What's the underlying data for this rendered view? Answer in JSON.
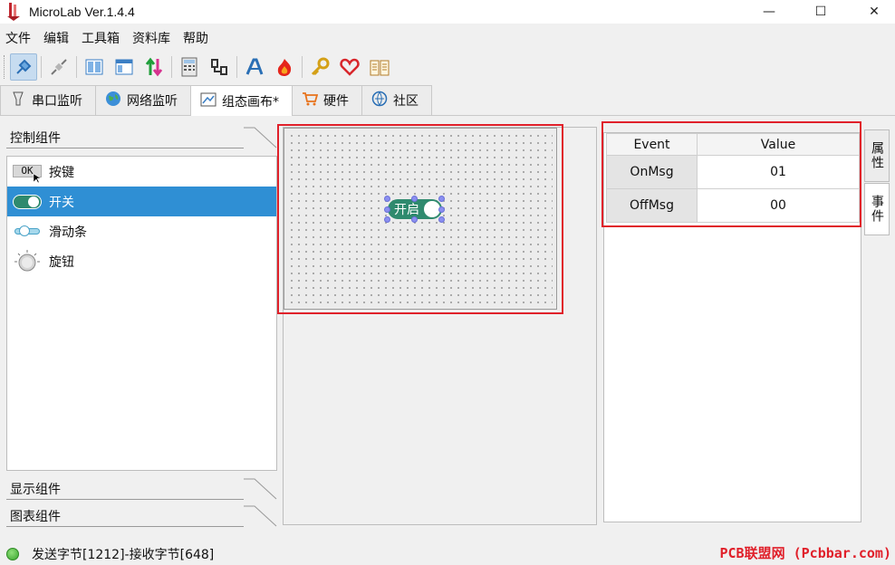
{
  "window": {
    "title": "MicroLab Ver.1.4.4",
    "minimize": "—",
    "maximize": "☐",
    "close": "✕"
  },
  "menu": [
    "文件",
    "编辑",
    "工具箱",
    "资料库",
    "帮助"
  ],
  "toolbar": {
    "icons": [
      "plug-icon",
      "disconnect-icon",
      "columns-icon",
      "layout-icon",
      "transfer-icon",
      "calculator-icon",
      "connector-icon",
      "font-icon",
      "flame-icon",
      "key-icon",
      "heart-icon",
      "book-icon"
    ]
  },
  "tabs": [
    {
      "label": "串口监听",
      "icon": "serial-icon"
    },
    {
      "label": "网络监听",
      "icon": "globe-icon"
    },
    {
      "label": "组态画布*",
      "icon": "canvas-icon",
      "active": true
    },
    {
      "label": "硬件",
      "icon": "cart-icon"
    },
    {
      "label": "社区",
      "icon": "community-icon"
    }
  ],
  "left_panel": {
    "control_header": "控制组件",
    "components": [
      {
        "label": "按键",
        "icon_text": "OK"
      },
      {
        "label": "开关",
        "selected": true
      },
      {
        "label": "滑动条"
      },
      {
        "label": "旋钮"
      }
    ],
    "display_header": "显示组件",
    "chart_header": "图表组件"
  },
  "canvas": {
    "switch_label": "开启"
  },
  "properties": {
    "col_event": "Event",
    "col_value": "Value",
    "rows": [
      {
        "event": "OnMsg",
        "value": "01"
      },
      {
        "event": "OffMsg",
        "value": "00"
      }
    ]
  },
  "side_tabs": [
    "属性",
    "事件"
  ],
  "status": {
    "text": "发送字节[1212]-接收字节[648]",
    "watermark": "PCB联盟网 (Pcbbar.com)",
    "led_color": "#3aa52e"
  },
  "colors": {
    "accent": "#2f8fd4",
    "switch_green": "#2f8a6e",
    "highlight_red": "#e0202a"
  }
}
